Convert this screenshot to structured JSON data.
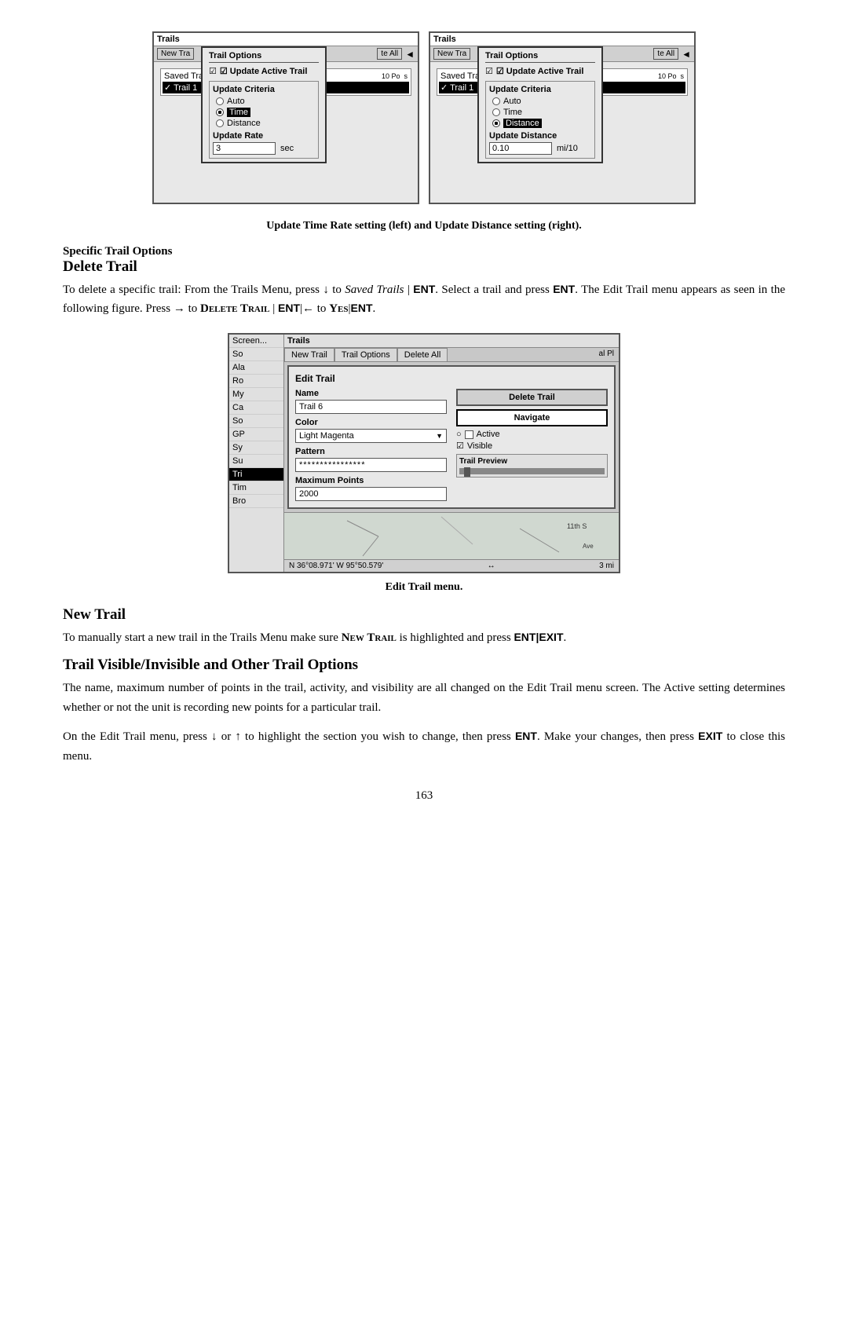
{
  "page": {
    "number": "163"
  },
  "caption_top": {
    "text": "Update Time Rate setting (left) and Update Distance setting (right)."
  },
  "section1": {
    "heading_small": "Specific Trail Options",
    "heading_large": "Delete Trail",
    "para1": "To delete a specific trail: From the Trails Menu, press ↓ to Saved Trails | ENT. Select a trail and press ENT. The Edit Trail menu appears as seen in the following figure. Press → to DELETE TRAIL | ENT|← to YES|ENT.",
    "caption_fig": "Edit Trail menu."
  },
  "section2": {
    "heading": "New Trail",
    "para": "To manually start a new trail in the Trails Menu make sure NEW TRAIL is highlighted and press ENT|EXIT."
  },
  "section3": {
    "heading": "Trail Visible/Invisible and Other Trail Options",
    "para": "The name, maximum number of points in the trail, activity, and visibility are all changed on the Edit Trail menu screen. The Active setting determines whether or not the unit is recording new points for a particular trail."
  },
  "section4": {
    "para": "On the Edit Trail menu, press ↓ or ↑ to highlight the section you wish to change, then press ENT. Make your changes, then press EXIT to close this menu."
  },
  "left_screen": {
    "title": "Trails",
    "toolbar_btn1": "New Tra",
    "toolbar_btn2": "te All",
    "saved_trails_label": "Saved Trai",
    "trail1": "✓ Trail 1",
    "trail_options_title": "Trail Options",
    "menu_item1": "☑ Update Active Trail",
    "update_criteria_title": "Update Criteria",
    "radio_auto": "Auto",
    "radio_time": "Time",
    "radio_distance": "Distance",
    "selected_radio": "time",
    "update_rate_title": "Update Rate",
    "rate_value": "3",
    "rate_unit": "sec"
  },
  "right_screen": {
    "title": "Trails",
    "toolbar_btn1": "New Tra",
    "toolbar_btn2": "te All",
    "saved_trails_label": "Saved Trai",
    "trail1": "✓ Trail 1",
    "trail_options_title": "Trail Options",
    "menu_item1": "☑ Update Active Trail",
    "update_criteria_title": "Update Criteria",
    "radio_auto": "Auto",
    "radio_time": "Time",
    "radio_distance": "Distance",
    "selected_radio": "distance",
    "update_distance_title": "Update Distance",
    "rate_value": "0.10",
    "rate_unit": "mi/10"
  },
  "edit_trail_dialog": {
    "sidebar_items": [
      "Screen...",
      "So",
      "Ala",
      "Ro",
      "My",
      "Ca",
      "So",
      "GP",
      "Sy",
      "Su",
      "Tri",
      "Tim",
      "Bro"
    ],
    "trails_header": "Trails",
    "tabs": [
      "New Trail",
      "Trail Options",
      "Delete All"
    ],
    "panel_title": "Edit Trail",
    "name_label": "Name",
    "name_value": "Trail 6",
    "color_label": "Color",
    "color_value": "Light Magenta",
    "pattern_label": "Pattern",
    "pattern_value": "****************",
    "max_points_label": "Maximum Points",
    "max_points_value": "2000",
    "delete_btn": "Delete Trail",
    "navigate_btn": "Navigate",
    "active_label": "Active",
    "active_checked": false,
    "visible_label": "Visible",
    "visible_checked": true,
    "trail_preview_label": "Trail Preview",
    "coords": "N  36°08.971'  W  95°50.579'",
    "scale": "3 mi"
  }
}
